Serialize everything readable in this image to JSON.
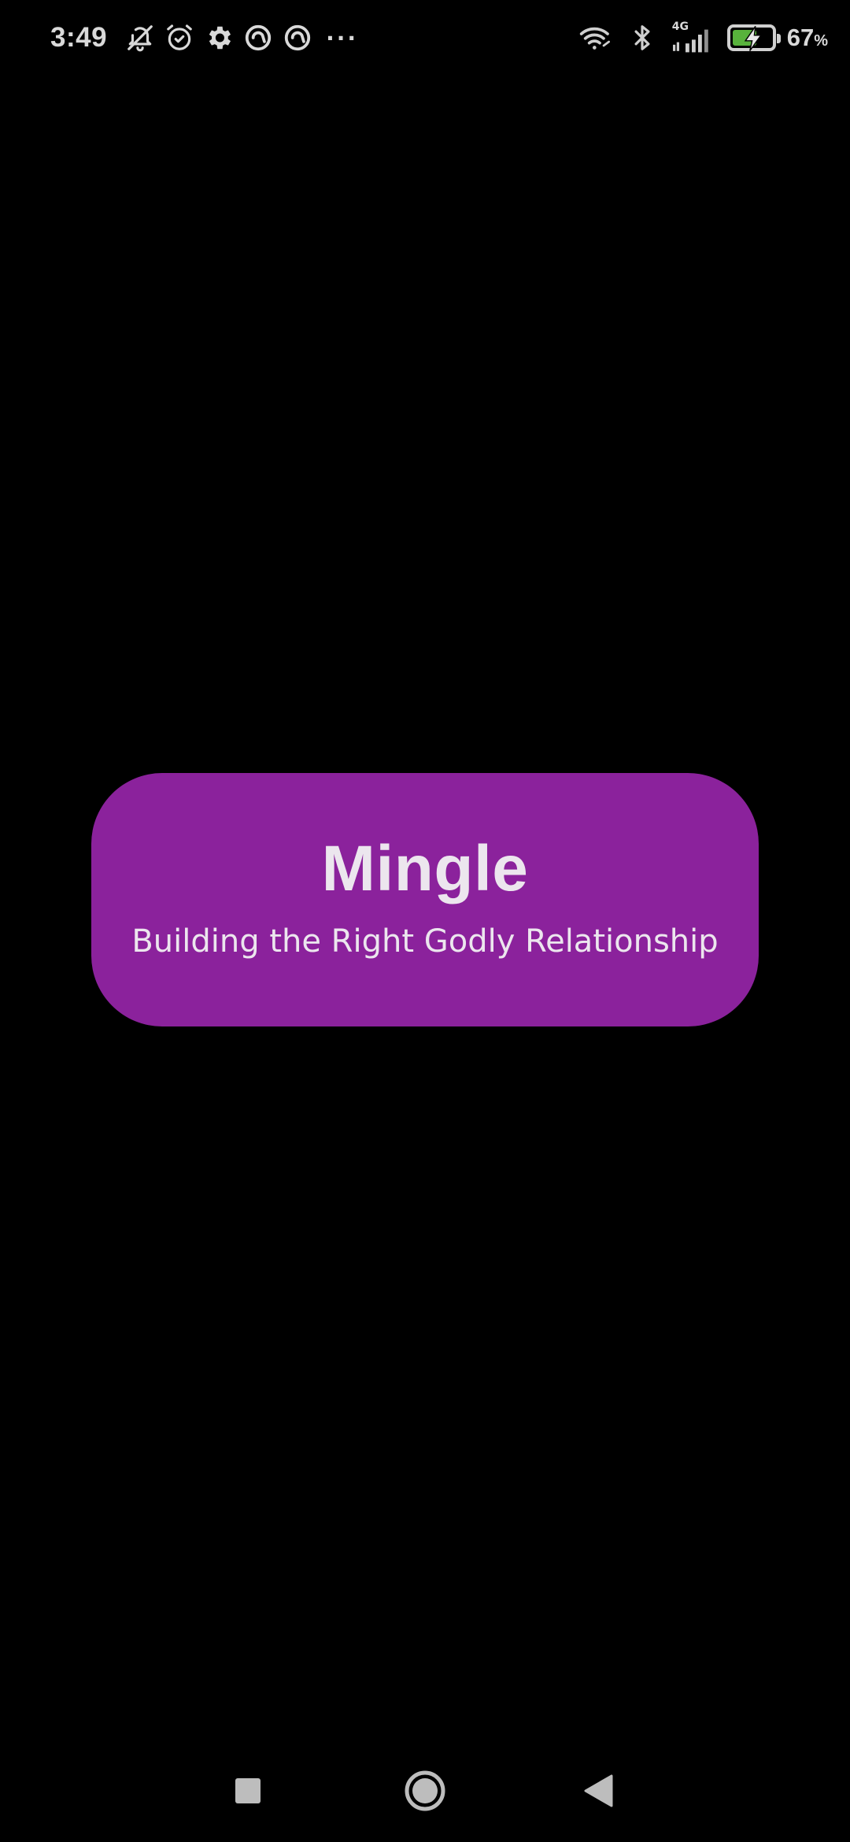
{
  "status_bar": {
    "time": "3:49",
    "network_type": "4G",
    "battery_percent": "67",
    "battery_percent_sign": "%",
    "battery_level": 0.67,
    "left_icons": [
      "bell-off-icon",
      "alarm-icon",
      "settings-gear-icon",
      "at-sign-icon",
      "at-sign-icon",
      "more-dots-icon"
    ],
    "right_icons": [
      "wifi-icon",
      "bluetooth-icon",
      "cellular-signal-icon",
      "battery-charging-icon"
    ],
    "more_dots": "···"
  },
  "splash": {
    "title": "Mingle",
    "tagline": "Building the Right Godly Relationship",
    "card_color": "#8b229c"
  },
  "nav_bar": {
    "buttons": [
      "recents-square-icon",
      "home-circle-icon",
      "back-triangle-icon"
    ]
  }
}
